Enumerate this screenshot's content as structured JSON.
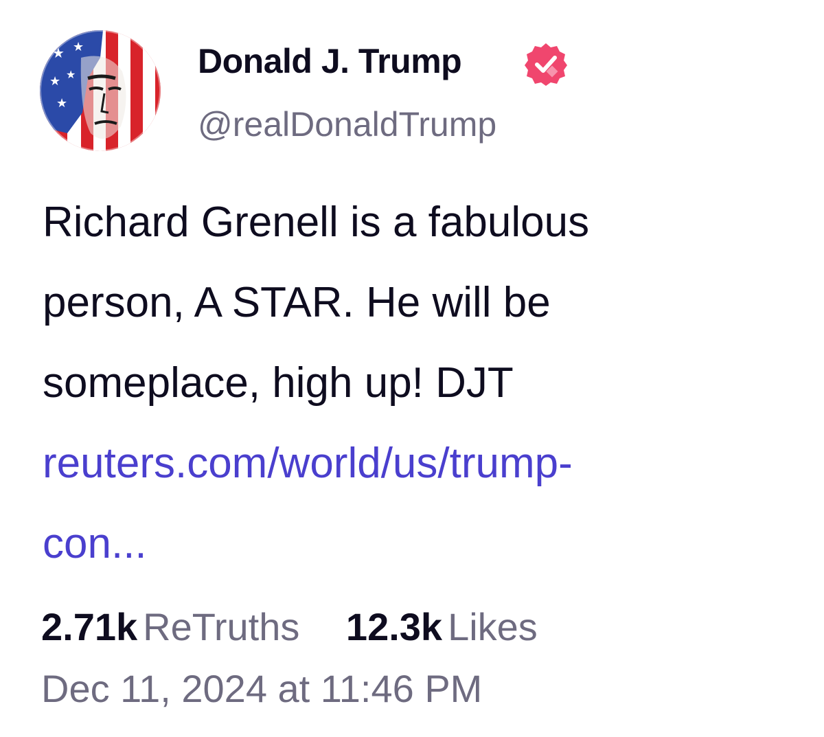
{
  "author": {
    "name": "Donald J. Trump",
    "handle": "@realDonaldTrump",
    "verified_icon": "verified-badge-icon",
    "verified_color": "#f0466e"
  },
  "post": {
    "text_lines": [
      "Richard Grenell is a fabulous",
      "person, A STAR. He will be",
      "someplace, high up! DJT"
    ],
    "link_lines": [
      "reuters.com/world/us/trump-",
      "con..."
    ],
    "link_color": "#4a3fce"
  },
  "stats": {
    "retruths_count": "2.71k",
    "retruths_label": "ReTruths",
    "likes_count": "12.3k",
    "likes_label": "Likes"
  },
  "timestamp": "Dec 11, 2024 at 11:46 PM"
}
